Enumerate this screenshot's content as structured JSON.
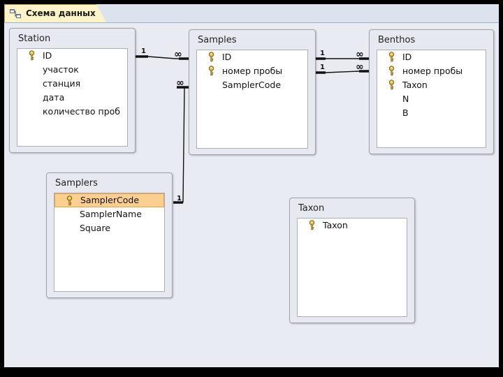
{
  "tab": {
    "label": "Схема данных",
    "icon": "relationships-icon"
  },
  "tables": {
    "station": {
      "title": "Station",
      "fields": [
        {
          "name": "ID",
          "key": true
        },
        {
          "name": "участок",
          "key": false
        },
        {
          "name": "станция",
          "key": false
        },
        {
          "name": "дата",
          "key": false
        },
        {
          "name": "количество проб",
          "key": false
        }
      ]
    },
    "samples": {
      "title": "Samples",
      "fields": [
        {
          "name": "ID",
          "key": true
        },
        {
          "name": "номер пробы",
          "key": true
        },
        {
          "name": "SamplerCode",
          "key": false
        }
      ]
    },
    "benthos": {
      "title": "Benthos",
      "fields": [
        {
          "name": "ID",
          "key": true
        },
        {
          "name": "номер пробы",
          "key": true
        },
        {
          "name": "Taxon",
          "key": true
        },
        {
          "name": "N",
          "key": false
        },
        {
          "name": "B",
          "key": false
        }
      ]
    },
    "samplers": {
      "title": "Samplers",
      "fields": [
        {
          "name": "SamplerCode",
          "key": true,
          "selected": true
        },
        {
          "name": "SamplerName",
          "key": false
        },
        {
          "name": "Square",
          "key": false
        }
      ]
    },
    "taxon": {
      "title": "Taxon",
      "fields": [
        {
          "name": "Taxon",
          "key": true
        }
      ]
    }
  },
  "relationships": [
    {
      "from": "Station.ID",
      "to": "Samples.ID",
      "from_card": "1",
      "to_card": "∞"
    },
    {
      "from": "Samples.ID",
      "to": "Benthos.ID",
      "from_card": "1",
      "to_card": "∞"
    },
    {
      "from": "Samples.номер пробы",
      "to": "Benthos.номер пробы",
      "from_card": "1",
      "to_card": "∞"
    },
    {
      "from": "Samplers.SamplerCode",
      "to": "Samples.SamplerCode",
      "from_card": "1",
      "to_card": "∞"
    }
  ],
  "colors": {
    "selection": "#fbcf8f",
    "canvas": "#e8ebf2",
    "frame": "#000000"
  }
}
